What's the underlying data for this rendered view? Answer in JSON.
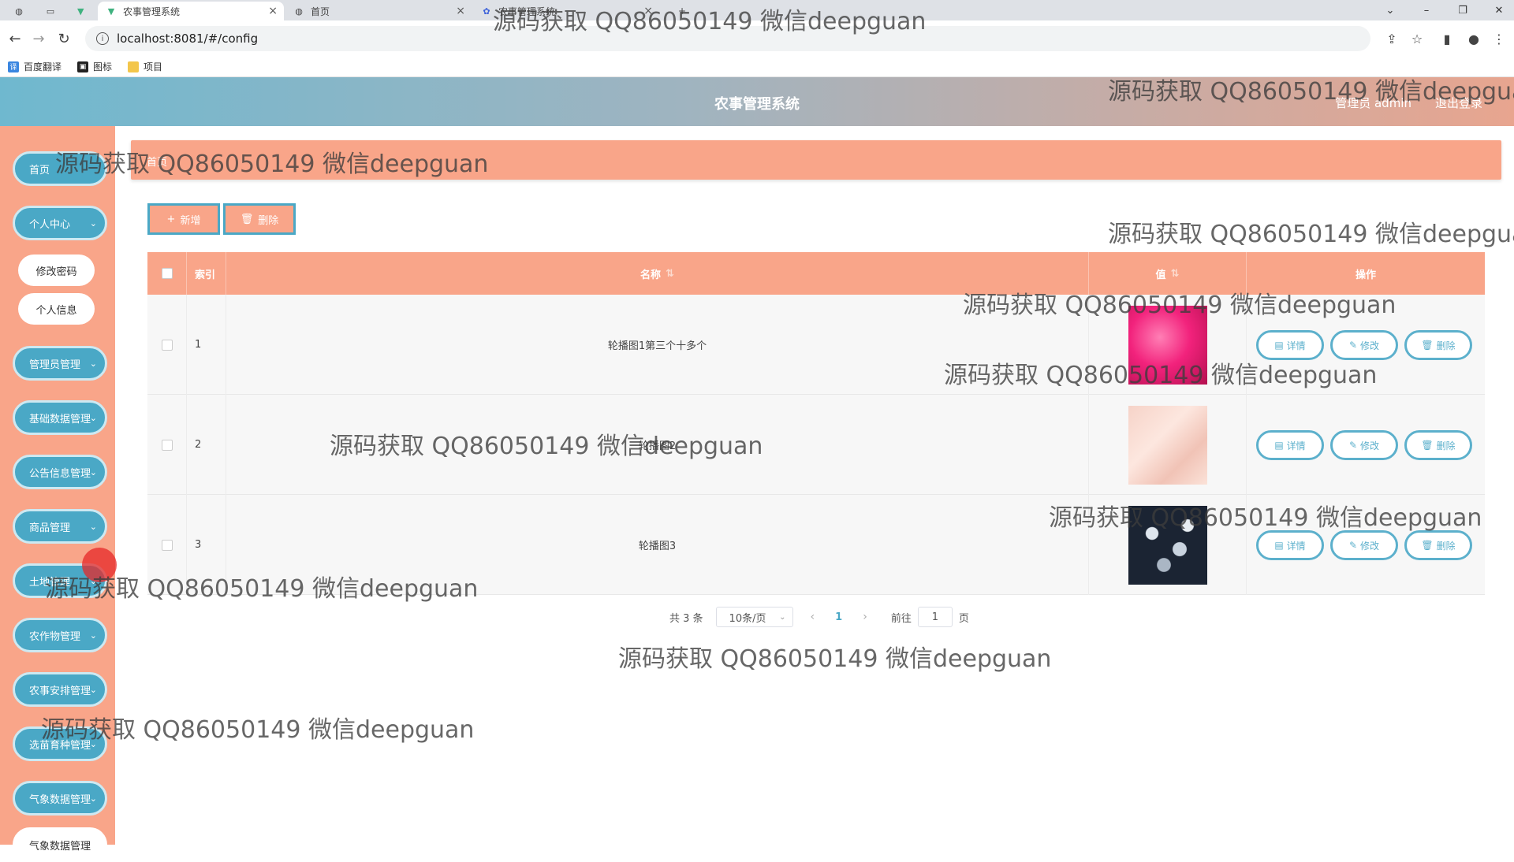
{
  "browser": {
    "tabs": [
      {
        "title": "农事管理系统",
        "active": true
      },
      {
        "title": "首页",
        "active": false
      },
      {
        "title": "农事管理系统",
        "active": false
      }
    ],
    "url": "localhost:8081/#/config",
    "bookmarks": [
      "百度翻译",
      "图标",
      "项目"
    ]
  },
  "header": {
    "title": "农事管理系统",
    "user": "管理员 admin",
    "logout": "退出登录"
  },
  "sidebar": {
    "items": [
      {
        "label": "首页",
        "expandable": false
      },
      {
        "label": "个人中心",
        "expandable": true
      },
      {
        "label": "修改密码",
        "sub": true
      },
      {
        "label": "个人信息",
        "sub": true
      },
      {
        "label": "管理员管理",
        "expandable": true
      },
      {
        "label": "基础数据管理",
        "expandable": true
      },
      {
        "label": "公告信息管理",
        "expandable": true
      },
      {
        "label": "商品管理",
        "expandable": true
      },
      {
        "label": "土地管理",
        "expandable": true
      },
      {
        "label": "农作物管理",
        "expandable": true
      },
      {
        "label": "农事安排管理",
        "expandable": true
      },
      {
        "label": "选苗育种管理",
        "expandable": true
      },
      {
        "label": "气象数据管理",
        "expandable": true
      },
      {
        "label": "气象数据管理",
        "expandable": true
      }
    ]
  },
  "breadcrumb": "首页",
  "toolbar": {
    "add_label": "新增",
    "delete_label": "删除"
  },
  "table": {
    "headers": [
      "索引",
      "名称",
      "值",
      "操作"
    ],
    "rows": [
      {
        "index": "1",
        "name": "轮播图1第三个十多个",
        "image": "pink-burst"
      },
      {
        "index": "2",
        "name": "轮播图2",
        "image": "peach-silk"
      },
      {
        "index": "3",
        "name": "轮播图3",
        "image": "dark-stones"
      }
    ],
    "row_actions": [
      "详情",
      "修改",
      "删除"
    ]
  },
  "pagination": {
    "total": "共 3 条",
    "page_size": "10条/页",
    "current": "1",
    "goto_prefix": "前往",
    "goto_value": "1",
    "goto_suffix": "页"
  },
  "watermark": "源码获取 QQ86050149 微信deepguan",
  "colors": {
    "accent": "#f9a589",
    "primary": "#4aa8c6"
  }
}
